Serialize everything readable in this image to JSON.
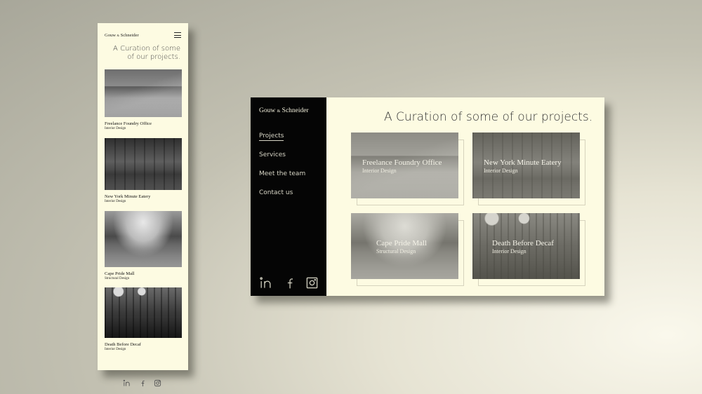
{
  "brand": "Gouw & Schneider",
  "brand_parts": {
    "first": "Gouw ",
    "amp": "&",
    "last": " Schneider"
  },
  "headline": "A Curation of some of our projects.",
  "mobile": {
    "headline_line1": "A Curation of some",
    "headline_line2": "of our projects.",
    "menu_icon": "hamburger-icon"
  },
  "nav": {
    "items": [
      {
        "label": "Projects",
        "active": true
      },
      {
        "label": "Services",
        "active": false
      },
      {
        "label": "Meet the team",
        "active": false
      },
      {
        "label": "Contact us",
        "active": false
      }
    ]
  },
  "projects": [
    {
      "title": "Freelance Foundry Office",
      "category": "Interior Design"
    },
    {
      "title": "New York Minute Eatery",
      "category": "Interior Design"
    },
    {
      "title": "Cape Pride Mall",
      "category": "Structural Design"
    },
    {
      "title": "Death Before Decaf",
      "category": "Interior Design"
    }
  ],
  "social": [
    "linkedin-icon",
    "facebook-icon",
    "instagram-icon"
  ],
  "colors": {
    "cream": "#fdfbe2",
    "sidebar": "#050505",
    "text_dark": "#333333"
  }
}
